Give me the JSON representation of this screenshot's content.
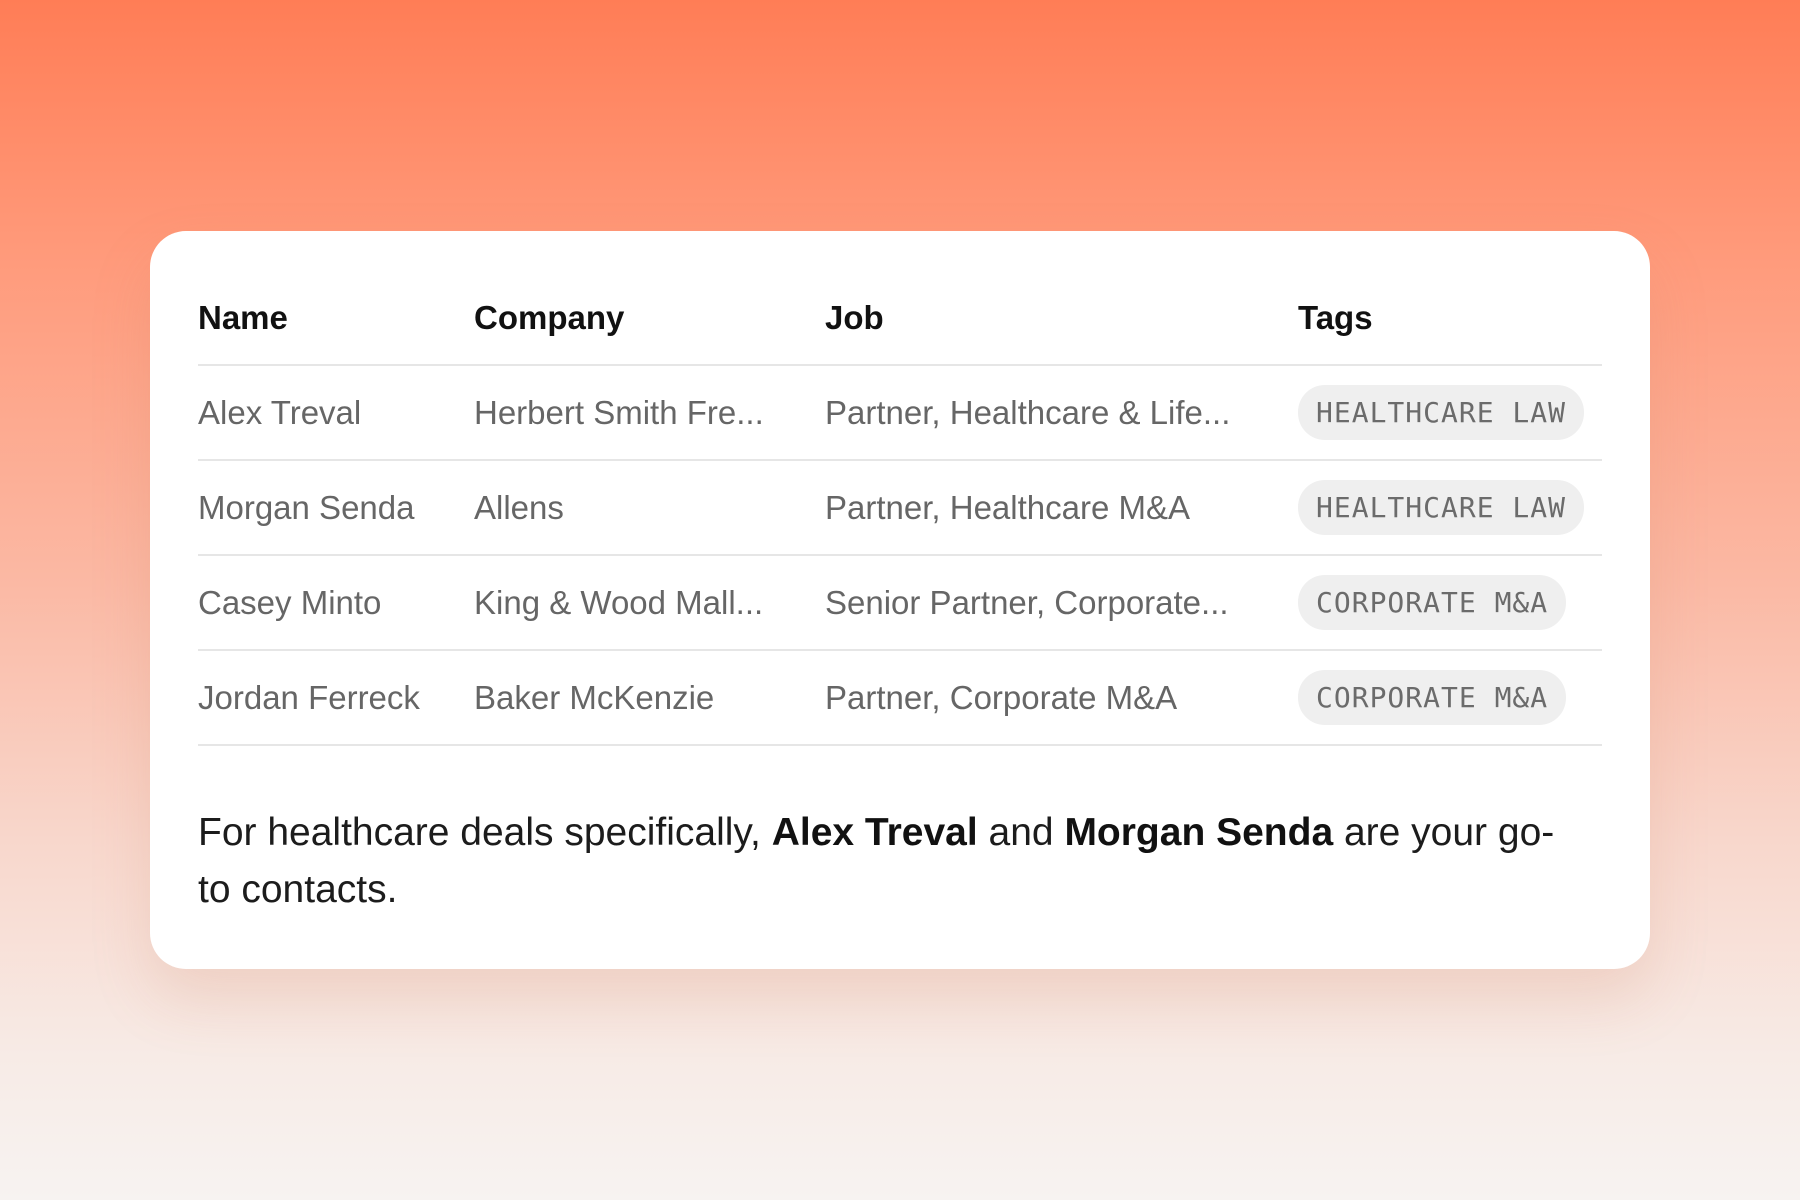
{
  "table": {
    "headers": {
      "name": "Name",
      "company": "Company",
      "job": "Job",
      "tags": "Tags"
    },
    "rows": [
      {
        "name": "Alex Treval",
        "company": "Herbert Smith Fre...",
        "job": "Partner, Healthcare & Life...",
        "tag": "HEALTHCARE LAW"
      },
      {
        "name": "Morgan Senda",
        "company": "Allens",
        "job": "Partner, Healthcare M&A",
        "tag": "HEALTHCARE LAW"
      },
      {
        "name": "Casey Minto",
        "company": "King & Wood Mall...",
        "job": "Senior Partner, Corporate...",
        "tag": "CORPORATE M&A"
      },
      {
        "name": "Jordan Ferreck",
        "company": "Baker McKenzie",
        "job": "Partner, Corporate M&A",
        "tag": "CORPORATE M&A"
      }
    ]
  },
  "summary": {
    "prefix": "For healthcare deals specifically, ",
    "contact_1": "Alex Treval",
    "middle": " and ",
    "contact_2": "Morgan Senda",
    "suffix": " are your go-to contacts."
  },
  "colors": {
    "background_top": "#ff7d56",
    "background_bottom": "#f7f3f1",
    "card": "#ffffff",
    "tag_background": "#efefef"
  }
}
